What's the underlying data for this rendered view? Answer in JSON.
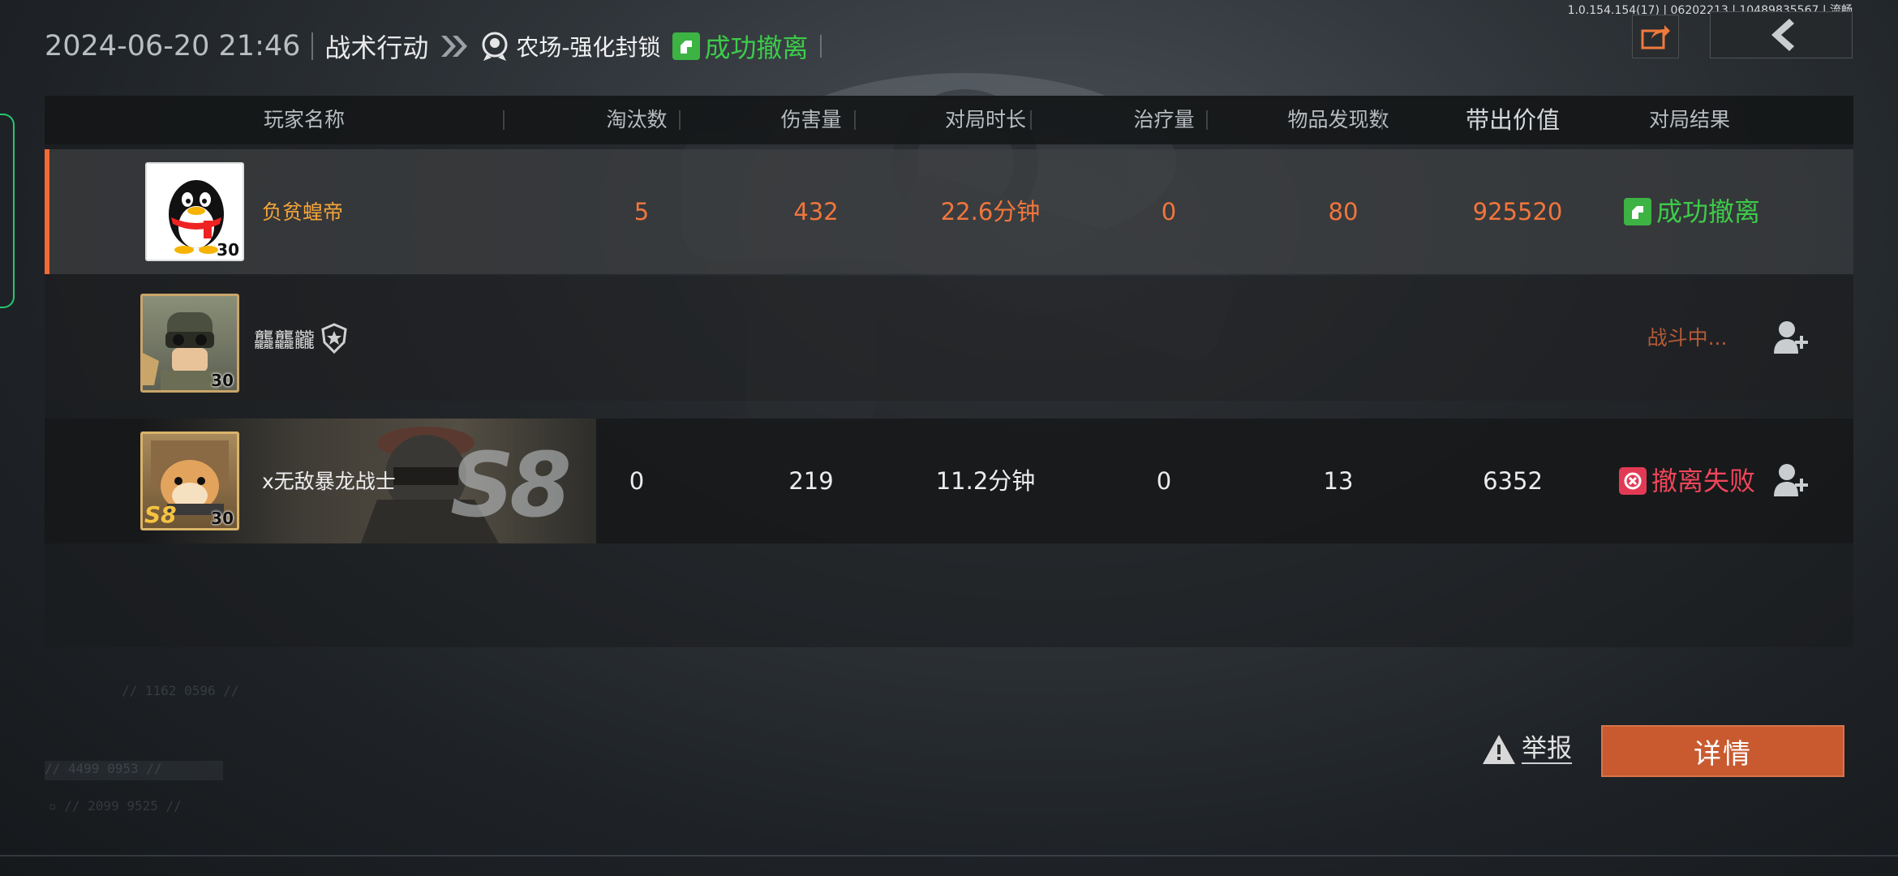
{
  "version_text": "1.0.154.154(17) | 06202213 | 10489835567 | 流畅",
  "header": {
    "datetime": "2024-06-20 21:46",
    "mode": "战术行动",
    "map": "农场-强化封锁",
    "result": "成功撤离"
  },
  "columns": [
    "玩家名称",
    "淘汰数",
    "伤害量",
    "对局时长",
    "治疗量",
    "物品发现数",
    "带出价值",
    "对局结果"
  ],
  "players": [
    {
      "name": "负贫蝗帝",
      "level": "30",
      "eliminations": "5",
      "damage": "432",
      "duration": "22.6分钟",
      "healing": "0",
      "items_found": "80",
      "value": "925520",
      "result": "成功撤离"
    },
    {
      "name": "龘龘龖",
      "level": "30",
      "status": "战斗中..."
    },
    {
      "name": "x无敌暴龙战士",
      "level": "30",
      "season_badge": "S8",
      "eliminations": "0",
      "damage": "219",
      "duration": "11.2分钟",
      "healing": "0",
      "items_found": "13",
      "value": "6352",
      "result": "撤离失败"
    }
  ],
  "buttons": {
    "report": "举报",
    "details": "详情"
  },
  "colors": {
    "accent_orange": "#f1763c",
    "success_green": "#3dcb4a",
    "fail_red": "#f0455a",
    "details_button": "#c95a30"
  }
}
